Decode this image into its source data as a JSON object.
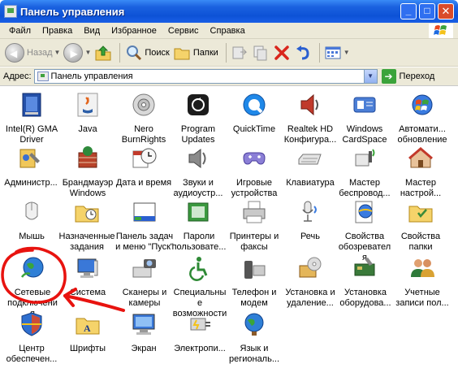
{
  "window": {
    "title": "Панель управления",
    "buttons": {
      "minimize": "_",
      "maximize": "□",
      "close": "✕"
    }
  },
  "menu": [
    "Файл",
    "Правка",
    "Вид",
    "Избранное",
    "Сервис",
    "Справка"
  ],
  "toolbar": {
    "back": "Назад",
    "forward": "",
    "search": "Поиск",
    "folders": "Папки",
    "view_icon": "views-icon"
  },
  "address": {
    "label": "Адрес:",
    "value": "Панель управления",
    "go": "Переход"
  },
  "items": [
    {
      "label": "Intel(R) GMA Driver",
      "icon": "intel-gma-icon"
    },
    {
      "label": "Java",
      "icon": "java-icon"
    },
    {
      "label": "Nero BurnRights",
      "icon": "nero-icon"
    },
    {
      "label": "Program Updates",
      "icon": "program-updates-icon"
    },
    {
      "label": "QuickTime",
      "icon": "quicktime-icon"
    },
    {
      "label": "Realtek HD Конфигура...",
      "icon": "realtek-icon"
    },
    {
      "label": "Windows CardSpace",
      "icon": "cardspace-icon"
    },
    {
      "label": "Автомати... обновление",
      "icon": "auto-update-icon"
    },
    {
      "label": "Администр...",
      "icon": "admin-tools-icon"
    },
    {
      "label": "Брандмауэр Windows",
      "icon": "firewall-icon"
    },
    {
      "label": "Дата и время",
      "icon": "datetime-icon"
    },
    {
      "label": "Звуки и аудиоустр...",
      "icon": "sounds-icon"
    },
    {
      "label": "Игровые устройства",
      "icon": "game-controller-icon"
    },
    {
      "label": "Клавиатура",
      "icon": "keyboard-icon"
    },
    {
      "label": "Мастер беспровод...",
      "icon": "wireless-wizard-icon"
    },
    {
      "label": "Мастер настрой...",
      "icon": "network-wizard-icon"
    },
    {
      "label": "Мышь",
      "icon": "mouse-icon"
    },
    {
      "label": "Назначенные задания",
      "icon": "scheduled-tasks-icon"
    },
    {
      "label": "Панель задач и меню \"Пуск\"",
      "icon": "taskbar-icon"
    },
    {
      "label": "Пароли пользовате...",
      "icon": "passwords-icon"
    },
    {
      "label": "Принтеры и факсы",
      "icon": "printer-icon"
    },
    {
      "label": "Речь",
      "icon": "speech-icon"
    },
    {
      "label": "Свойства обозревателя",
      "icon": "internet-options-icon"
    },
    {
      "label": "Свойства папки",
      "icon": "folder-options-icon"
    },
    {
      "label": "Сетевые подключения",
      "icon": "network-connections-icon"
    },
    {
      "label": "Система",
      "icon": "system-icon"
    },
    {
      "label": "Сканеры и камеры",
      "icon": "scanner-icon"
    },
    {
      "label": "Специальные возможности",
      "icon": "accessibility-icon"
    },
    {
      "label": "Телефон и модем",
      "icon": "phone-modem-icon"
    },
    {
      "label": "Установка и удаление...",
      "icon": "add-remove-icon"
    },
    {
      "label": "Установка оборудова...",
      "icon": "add-hardware-icon"
    },
    {
      "label": "Учетные записи пол...",
      "icon": "user-accounts-icon"
    },
    {
      "label": "Центр обеспечен...",
      "icon": "security-center-icon"
    },
    {
      "label": "Шрифты",
      "icon": "fonts-icon"
    },
    {
      "label": "Экран",
      "icon": "display-icon"
    },
    {
      "label": "Электропи...",
      "icon": "power-icon"
    },
    {
      "label": "Язык и региональ...",
      "icon": "regional-icon"
    }
  ],
  "annotation_color": "#e8130f",
  "colors": {
    "titlebar": "#0d52d6",
    "chrome": "#ece9d8"
  }
}
